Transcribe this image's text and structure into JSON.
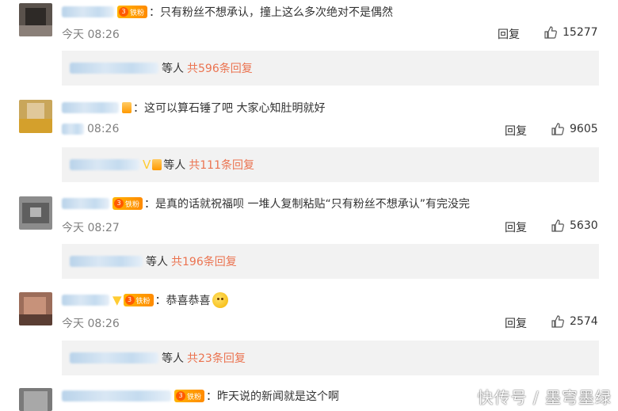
{
  "comments": [
    {
      "text": "：只有粉丝不想承认，撞上这么多次绝对不是偶然",
      "badge": "铁粉",
      "time": "今天 08:26",
      "reply": "回复",
      "likes": "15277",
      "sub_mid": "等人",
      "sub_link": "共596条回复"
    },
    {
      "text": "：这可以算石锤了吧 大家心知肚明就好",
      "time": "08:26",
      "reply": "回复",
      "likes": "9605",
      "sub_mid": "等人",
      "sub_link": "共111条回复"
    },
    {
      "text": "：是真的话就祝福呗 一堆人复制粘贴“只有粉丝不想承认”有完没完",
      "badge": "铁粉",
      "time": "今天 08:27",
      "reply": "回复",
      "likes": "5630",
      "sub_mid": "等人",
      "sub_link": "共196条回复"
    },
    {
      "text": "：恭喜恭喜",
      "badge": "铁粉",
      "time": "今天 08:26",
      "reply": "回复",
      "likes": "2574",
      "sub_mid": "等人",
      "sub_link": "共23条回复"
    },
    {
      "text": "：昨天说的新闻就是这个啊",
      "badge": "铁粉"
    }
  ],
  "watermark": "快传号 / 墨穹墨绿",
  "icons": {
    "like": "thumbs-up-icon",
    "badge": "fan-badge-icon"
  }
}
